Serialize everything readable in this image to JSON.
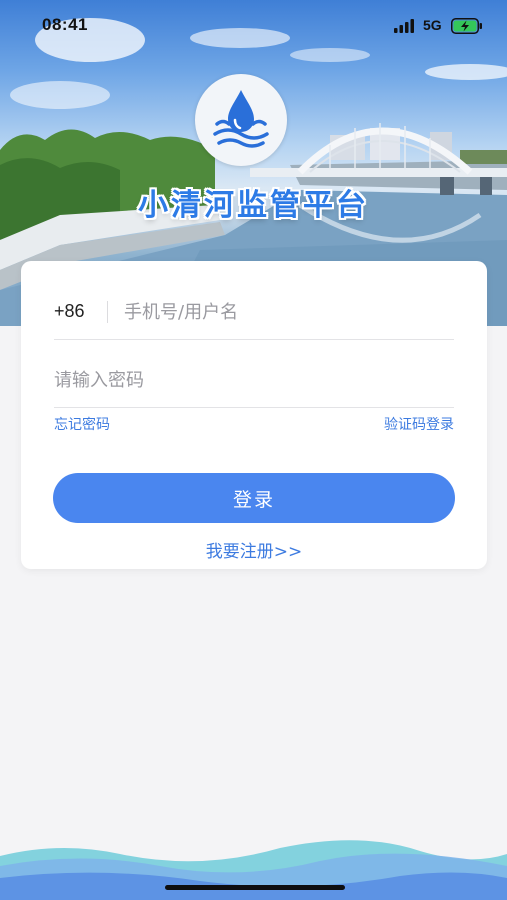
{
  "status_bar": {
    "time": "08:41",
    "network": "5G"
  },
  "header": {
    "app_title": "小清河监管平台",
    "logo_icon": "water-drop-waves-icon"
  },
  "login_form": {
    "country_code": "+86",
    "phone_placeholder": "手机号/用户名",
    "password_placeholder": "请输入密码",
    "forgot_password_label": "忘记密码",
    "sms_login_label": "验证码登录",
    "login_button_label": "登录",
    "register_link_label": "我要注册>>"
  },
  "colors": {
    "accent": "#4a86ef",
    "link": "#3d7be0",
    "title": "#2d7be6",
    "background": "#f4f4f6"
  }
}
